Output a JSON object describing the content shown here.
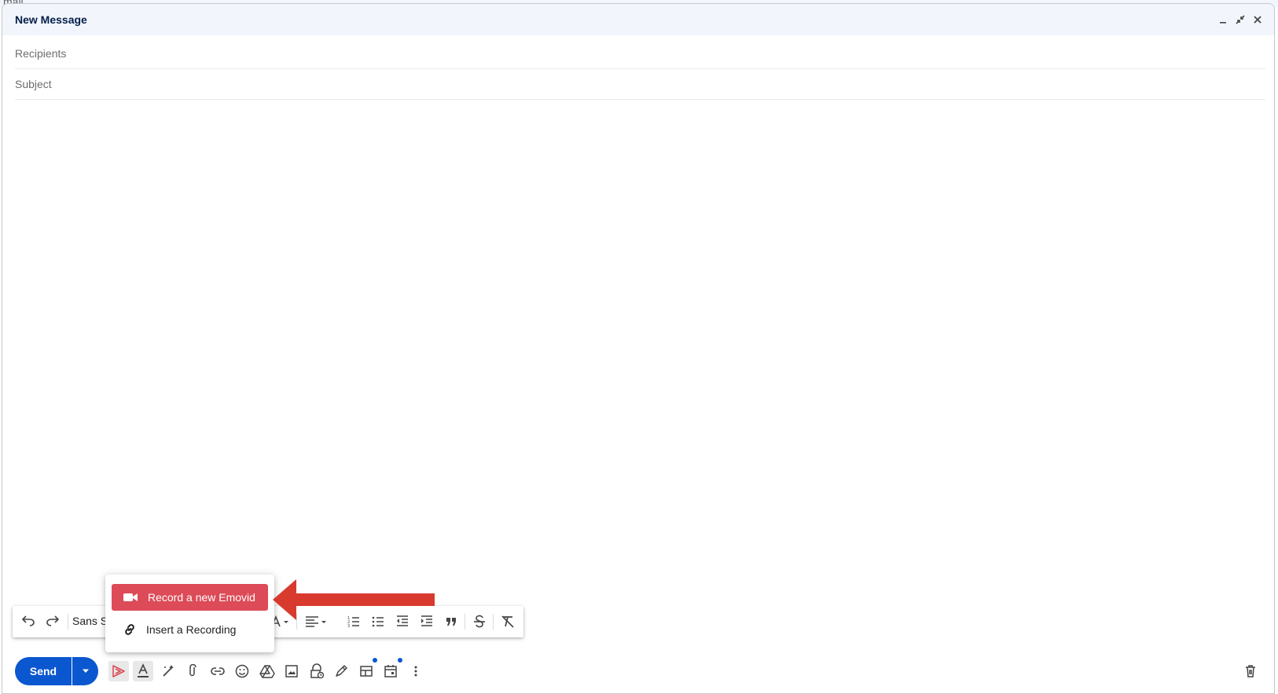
{
  "window": {
    "title": "New Message"
  },
  "fields": {
    "recipients_placeholder": "Recipients",
    "subject_placeholder": "Subject"
  },
  "format_toolbar": {
    "font_family": "Sans S"
  },
  "emovid_menu": {
    "record_label": "Record a new Emovid",
    "insert_label": "Insert a Recording"
  },
  "actions": {
    "send_label": "Send"
  },
  "colors": {
    "send_blue": "#0b57d0",
    "emovid_red": "#dc4b57",
    "arrow_red": "#d93a2e",
    "titlebar_bg": "#f2f6fc"
  },
  "icons": {
    "toolbar": [
      "undo-icon",
      "redo-icon",
      "text-color-icon",
      "align-icon",
      "numbered-list-icon",
      "bulleted-list-icon",
      "indent-less-icon",
      "indent-more-icon",
      "quote-icon",
      "strikethrough-icon",
      "remove-formatting-icon"
    ],
    "bottom": [
      "emovid-icon",
      "formatting-options-icon",
      "magic-write-icon",
      "attach-icon",
      "link-icon",
      "emoji-icon",
      "drive-icon",
      "photo-icon",
      "confidential-icon",
      "signature-icon",
      "layouts-icon",
      "schedule-icon",
      "more-options-icon",
      "discard-draft-icon"
    ]
  }
}
